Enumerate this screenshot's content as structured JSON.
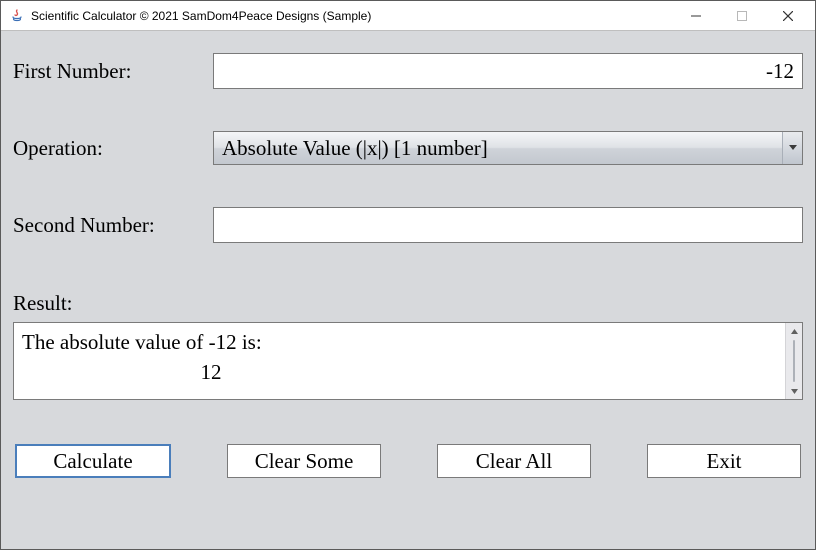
{
  "window": {
    "title": "Scientific Calculator © 2021 SamDom4Peace Designs (Sample)"
  },
  "labels": {
    "first_number": "First Number:",
    "operation": "Operation:",
    "second_number": "Second Number:",
    "result": "Result:"
  },
  "fields": {
    "first_number_value": "-12",
    "second_number_value": "",
    "operation_selected": "Absolute Value (|x|) [1 number]"
  },
  "result_text": "The absolute value of -12 is:\n                                  12",
  "buttons": {
    "calculate": "Calculate",
    "clear_some": "Clear Some",
    "clear_all": "Clear All",
    "exit": "Exit"
  }
}
